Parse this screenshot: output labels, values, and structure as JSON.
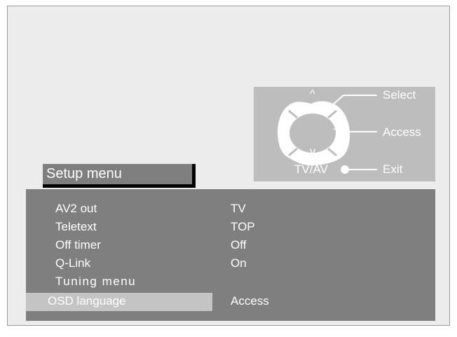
{
  "remote": {
    "select_label": "Select",
    "access_label": "Access",
    "exit_label": "Exit",
    "tvav_label": "TV/AV",
    "plus_symbol": "+",
    "minus_symbol": "−",
    "up_symbol": "^",
    "down_symbol": "v"
  },
  "menu": {
    "title": "Setup menu",
    "items": [
      {
        "label": "AV2 out",
        "value": "TV"
      },
      {
        "label": "Teletext",
        "value": "TOP"
      },
      {
        "label": "Off timer",
        "value": "Off"
      },
      {
        "label": "Q-Link",
        "value": "On"
      },
      {
        "label": "Tuning menu",
        "value": ""
      },
      {
        "label": "OSD language",
        "value": "Access",
        "selected": true
      }
    ]
  },
  "colors": {
    "panel": "#7f7f7f",
    "remote_bg": "#bdbdbd",
    "highlight": "#c4c4c4",
    "screen_bg": "#ececec"
  }
}
